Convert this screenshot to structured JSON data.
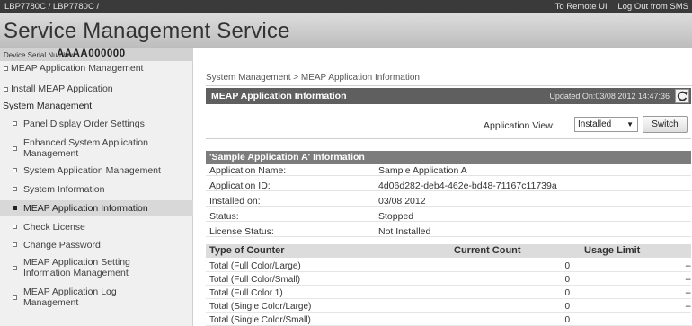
{
  "topbar": {
    "path": "LBP7780C / LBP7780C /",
    "to_remote_ui": "To Remote UI",
    "log_out": "Log Out from SMS"
  },
  "title": "Service Management Service",
  "device": {
    "serial_label": "Device Serial Number:",
    "serial_value": "AAAA000000"
  },
  "sidebar": {
    "items_top": [
      {
        "label": "MEAP Application Management"
      },
      {
        "label": "Install MEAP Application"
      }
    ],
    "section_label": "System Management",
    "items": [
      {
        "label": "Panel Display Order Settings"
      },
      {
        "label": "Enhanced System Application Management"
      },
      {
        "label": "System Application Management"
      },
      {
        "label": "System Information"
      },
      {
        "label": "MEAP Application Information"
      },
      {
        "label": "Check License"
      },
      {
        "label": "Change Password"
      },
      {
        "label": "MEAP Application Setting Information Management"
      },
      {
        "label": "MEAP Application Log Management"
      }
    ]
  },
  "main": {
    "breadcrumb": "System Management > MEAP Application Information",
    "section_title": "MEAP Application Information",
    "updated": "Updated On:03/08 2012 14:47:36",
    "app_view_label": "Application View:",
    "app_view_value": "Installed",
    "switch_label": "Switch",
    "info_title": "'Sample Application A' Information",
    "info_rows": [
      {
        "key": "Application Name:",
        "value": "Sample Application A"
      },
      {
        "key": "Application ID:",
        "value": "4d06d282-deb4-462e-bd48-71167c11739a"
      },
      {
        "key": "Installed on:",
        "value": "03/08 2012"
      },
      {
        "key": "Status:",
        "value": "Stopped"
      },
      {
        "key": "License Status:",
        "value": "Not Installed"
      }
    ],
    "counter_headers": {
      "type": "Type of Counter",
      "count": "Current Count",
      "limit": "Usage Limit"
    },
    "counters": [
      {
        "name": "Total (Full Color/Large)",
        "count": "0",
        "limit": "--"
      },
      {
        "name": "Total (Full Color/Small)",
        "count": "0",
        "limit": "--"
      },
      {
        "name": "Total (Full Color 1)",
        "count": "0",
        "limit": "--"
      },
      {
        "name": "Total (Single Color/Large)",
        "count": "0",
        "limit": "--"
      },
      {
        "name": "Total (Single Color/Small)",
        "count": "0",
        "limit": ""
      }
    ]
  }
}
